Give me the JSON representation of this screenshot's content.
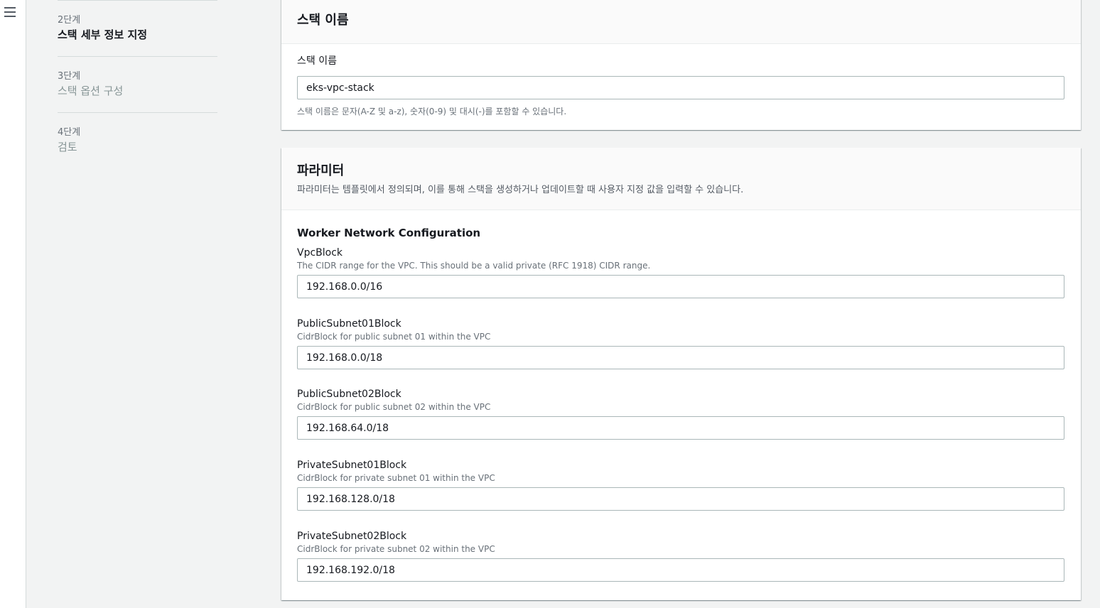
{
  "sidebar": {
    "steps": [
      {
        "num": "2단계",
        "title": "스택 세부 정보 지정"
      },
      {
        "num": "3단계",
        "title": "스택 옵션 구성"
      },
      {
        "num": "4단계",
        "title": "검토"
      }
    ]
  },
  "stack_name_panel": {
    "title": "스택 이름",
    "field_label": "스택 이름",
    "value": "eks-vpc-stack",
    "hint": "스택 이름은 문자(A-Z 및 a-z), 숫자(0-9) 및 대시(-)를 포함할 수 있습니다."
  },
  "parameters_panel": {
    "title": "파라미터",
    "description": "파라미터는 템플릿에서 정의되며, 이를 통해 스택을 생성하거나 업데이트할 때 사용자 지정 값을 입력할 수 있습니다.",
    "section_heading": "Worker Network Configuration",
    "params": [
      {
        "name": "VpcBlock",
        "description": "The CIDR range for the VPC. This should be a valid private (RFC 1918) CIDR range.",
        "value": "192.168.0.0/16"
      },
      {
        "name": "PublicSubnet01Block",
        "description": "CidrBlock for public subnet 01 within the VPC",
        "value": "192.168.0.0/18"
      },
      {
        "name": "PublicSubnet02Block",
        "description": "CidrBlock for public subnet 02 within the VPC",
        "value": "192.168.64.0/18"
      },
      {
        "name": "PrivateSubnet01Block",
        "description": "CidrBlock for private subnet 01 within the VPC",
        "value": "192.168.128.0/18"
      },
      {
        "name": "PrivateSubnet02Block",
        "description": "CidrBlock for private subnet 02 within the VPC",
        "value": "192.168.192.0/18"
      }
    ]
  }
}
